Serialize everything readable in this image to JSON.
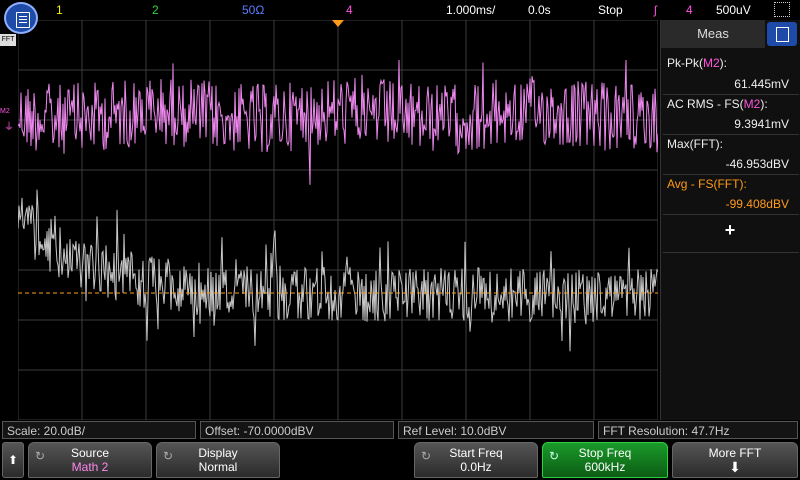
{
  "top_bar": {
    "ch1": "1",
    "ch2": "2",
    "ch3": "50Ω",
    "ch4": "4",
    "timebase": "1.000ms/",
    "delay": "0.0s",
    "run_state": "Stop",
    "trigger_source": "4",
    "trigger_level": "500uV"
  },
  "left_markers": {
    "fft_marker": "FFT",
    "m2_marker": "M2"
  },
  "meas_panel": {
    "tab_label": "Meas",
    "items": [
      {
        "label_prefix": "Pk-Pk(",
        "label_src": "M2",
        "label_suffix": "):",
        "value": "61.445mV"
      },
      {
        "label_prefix": "AC RMS - FS(",
        "label_src": "M2",
        "label_suffix": "):",
        "value": "9.3941mV"
      },
      {
        "label_prefix": "Max(",
        "label_src": "FFT",
        "label_suffix": "):",
        "value": "-46.953dBV"
      },
      {
        "label_prefix": "Avg - FS(",
        "label_src": "FFT",
        "label_suffix": "):",
        "value": "-99.408dBV"
      }
    ],
    "add_symbol": "+"
  },
  "info_row": {
    "scale": "Scale: 20.0dB/",
    "offset": "Offset: -70.0000dBV",
    "ref_level": "Ref Level: 10.0dBV",
    "fft_resolution": "FFT Resolution: 47.7Hz"
  },
  "softkeys": {
    "back_arrow": "⬆",
    "source_title": "Source",
    "source_value": "Math 2",
    "display_title": "Display",
    "display_value": "Normal",
    "start_title": "Start Freq",
    "start_value": "0.0Hz",
    "stop_title": "Stop Freq",
    "stop_value": "600kHz",
    "more_title": "More FFT",
    "more_arrow": "⬇"
  },
  "colors": {
    "m2_trace": "#ee88ee",
    "fft_trace": "#c8c8c8",
    "trigger_marker": "#ff9b1a",
    "green_key": "#1a9a2a"
  }
}
